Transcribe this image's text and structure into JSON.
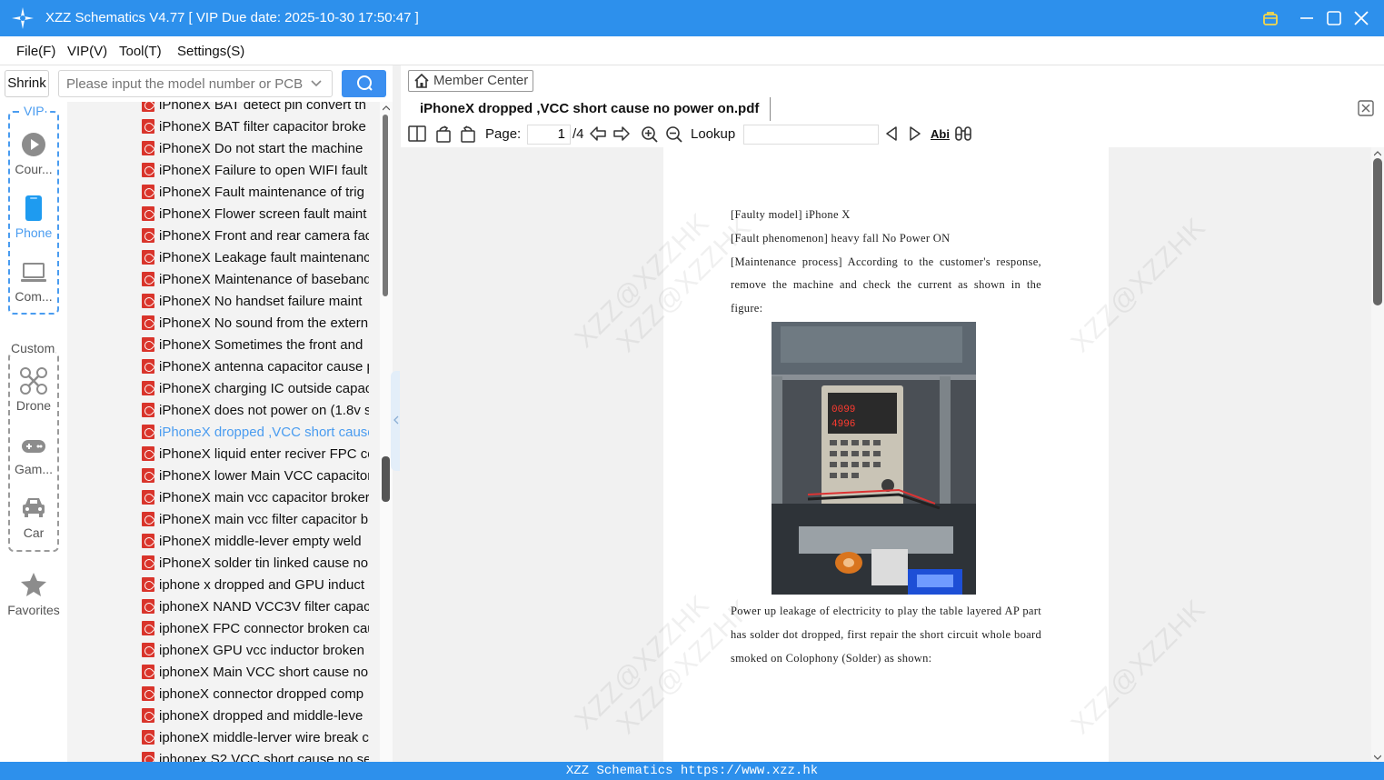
{
  "window": {
    "title": "XZZ Schematics V4.77 [ VIP Due date: 2025-10-30 17:50:47 ]"
  },
  "menu": [
    "File(F)",
    "VIP(V)",
    "Tool(T)",
    "Settings(S)"
  ],
  "search": {
    "shrink_label": "Shrink",
    "placeholder": "Please input the model number or PCB"
  },
  "nav": {
    "vip_tag": "VIP",
    "custom_tag": "Custom",
    "items": [
      {
        "label": "Cour...",
        "icon": "play-circle-icon"
      },
      {
        "label": "Phone",
        "icon": "phone-icon"
      },
      {
        "label": "Com...",
        "icon": "laptop-icon"
      },
      {
        "label": "Drone",
        "icon": "drone-icon"
      },
      {
        "label": "Gam...",
        "icon": "gamepad-icon"
      },
      {
        "label": "Car",
        "icon": "car-icon"
      },
      {
        "label": "Favorites",
        "icon": "star-icon"
      }
    ]
  },
  "files": [
    "iPhoneX BAT detect pin convert th",
    "iPhoneX BAT filter capacitor broke",
    "iPhoneX Do not start the machine",
    "iPhoneX Failure to open WIFI fault",
    "iPhoneX Fault maintenance of trig",
    "iPhoneX Flower screen fault maint",
    "iPhoneX Front and rear camera fac",
    "iPhoneX Leakage fault maintenanc",
    "iPhoneX Maintenance of baseband",
    "iPhoneX No handset failure maint",
    "iPhoneX No sound from the extern",
    "iPhoneX Sometimes the front and",
    "iPhoneX antenna capacitor cause p",
    "iPhoneX charging IC outside capac",
    "iPhoneX does not power on (1.8v s",
    "iPhoneX dropped ,VCC short cause",
    "iPhoneX liquid enter reciver FPC co",
    "iPhoneX lower Main VCC capacitor",
    "iPhoneX main vcc capacitor broker",
    "iPhoneX main vcc filter capacitor b",
    "iPhoneX middle-lever empty weld",
    "iPhoneX solder tin linked cause no",
    "iphone x dropped and GPU induct",
    "iphoneX  NAND VCC3V filter capac",
    "iphoneX FPC connector broken cau",
    "iphoneX GPU vcc inductor broken",
    "iphoneX Main VCC short cause no",
    "iphoneX connector dropped comp",
    "iphoneX dropped and middle-leve",
    "iphoneX middle-lerver wire break c",
    "iphonex S2 VCC short cause no ser"
  ],
  "active_file_index": 15,
  "viewer": {
    "member_center": "Member Center",
    "tab_title": "iPhoneX dropped ,VCC short cause no power on.pdf",
    "page_label": "Page:",
    "page_current": "1",
    "page_total": "/4",
    "lookup_label": "Lookup",
    "find_abc": "Abi"
  },
  "document": {
    "lines_top": [
      "[Faulty model] iPhone X",
      "[Fault phenomenon] heavy fall No Power ON",
      "[Maintenance process] According to the customer's response, remove the machine and check the current as shown in the figure:"
    ],
    "lines_bottom": "Power up leakage of electricity to play the table layered AP part has solder dot dropped, first repair the short circuit whole board smoked on Colophony (Solder) as shown:",
    "photo_display_top": "0099",
    "photo_display_bottom": "4996",
    "watermark": "XZZ@XZZHK"
  },
  "status_bar": "XZZ Schematics https://www.xzz.hk"
}
